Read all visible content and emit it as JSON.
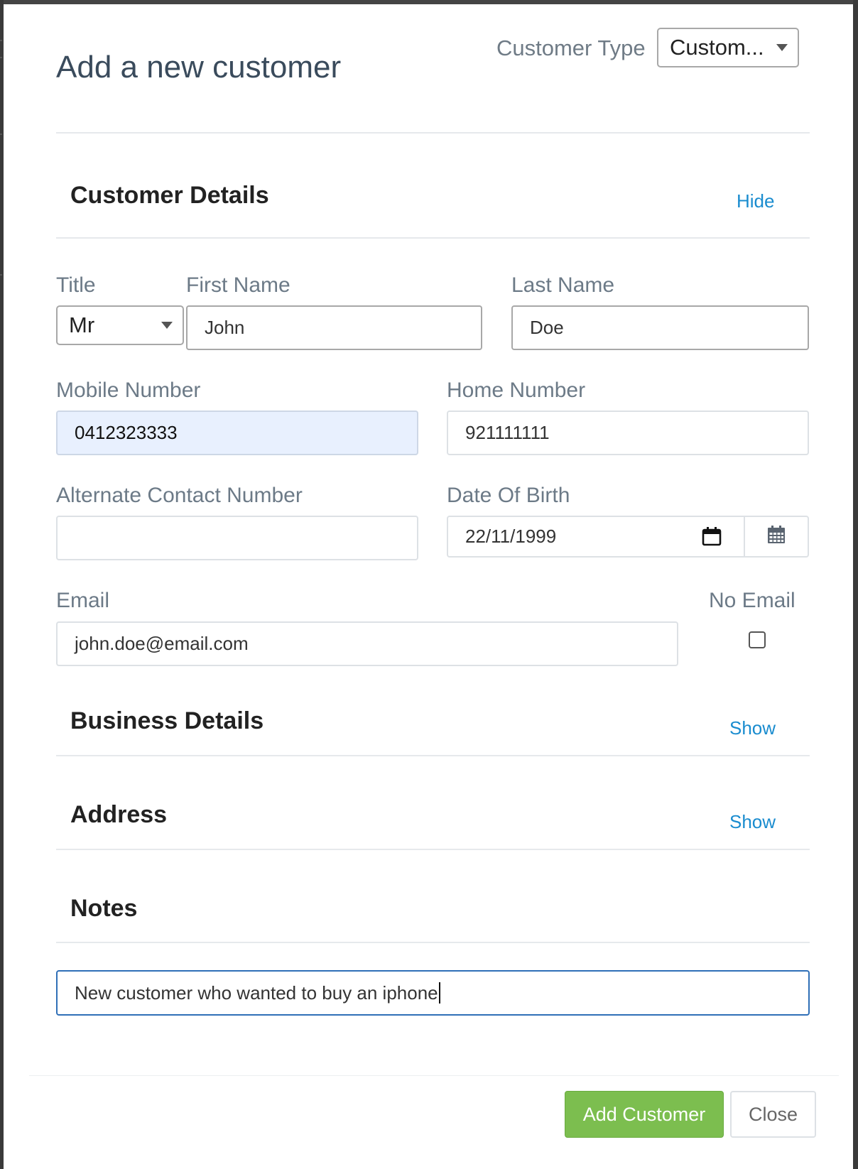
{
  "modal": {
    "title": "Add a new customer",
    "customer_type": {
      "label": "Customer Type",
      "selected": "Custom..."
    }
  },
  "sections": {
    "customer_details": {
      "title": "Customer Details",
      "toggle": "Hide"
    },
    "business_details": {
      "title": "Business Details",
      "toggle": "Show"
    },
    "address": {
      "title": "Address",
      "toggle": "Show"
    },
    "notes": {
      "title": "Notes"
    }
  },
  "fields": {
    "title": {
      "label": "Title",
      "value": "Mr"
    },
    "first_name": {
      "label": "First Name",
      "value": "John"
    },
    "last_name": {
      "label": "Last Name",
      "value": "Doe"
    },
    "mobile_number": {
      "label": "Mobile Number",
      "value": "0412323333"
    },
    "home_number": {
      "label": "Home Number",
      "value": "921111111"
    },
    "alternate_contact": {
      "label": "Alternate Contact Number",
      "value": ""
    },
    "date_of_birth": {
      "label": "Date Of Birth",
      "value": "22/11/1999"
    },
    "email": {
      "label": "Email",
      "value": "john.doe@email.com"
    },
    "no_email": {
      "label": "No Email",
      "checked": false
    },
    "notes": {
      "value": "New customer who wanted to buy an iphone"
    }
  },
  "footer": {
    "add_button": "Add Customer",
    "close_button": "Close"
  },
  "colors": {
    "link": "#1a8ccf",
    "primary_button": "#7cbe4f",
    "autofill_bg": "#e8f0fe",
    "focus_border": "#2f6fb7"
  },
  "icons": {
    "dropdown": "caret-down-icon",
    "native_date": "calendar-icon",
    "date_addon": "calendar-grid-icon"
  }
}
